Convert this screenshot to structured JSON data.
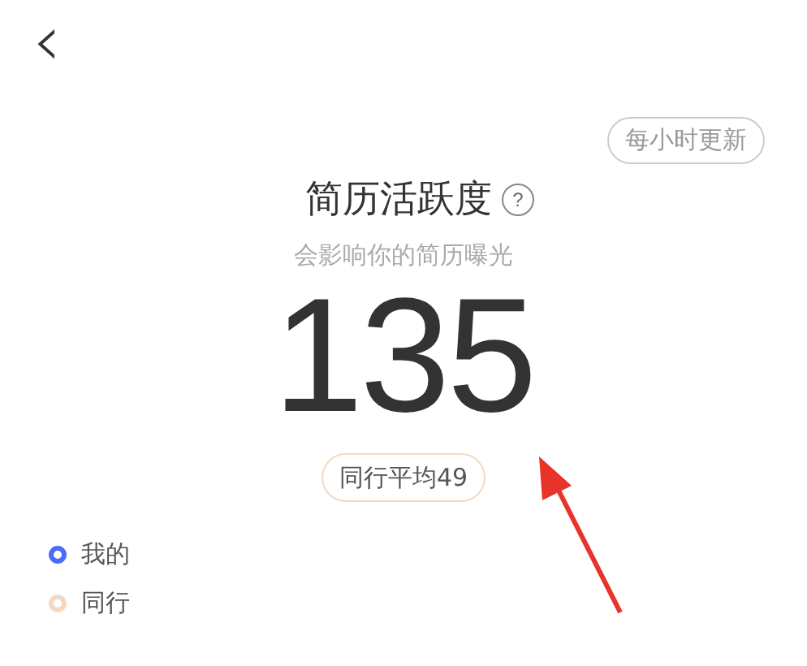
{
  "nav": {
    "back": "‹"
  },
  "update_badge": "每小时更新",
  "title": "简历活跃度",
  "help": "?",
  "subtitle": "会影响你的简历曝光",
  "score": "135",
  "peer_average": "同行平均49",
  "legend": [
    {
      "label": "我的",
      "color": "#4a6cf7"
    },
    {
      "label": "同行",
      "color": "#f3d9c3"
    }
  ],
  "annotation": {
    "kind": "arrow"
  }
}
